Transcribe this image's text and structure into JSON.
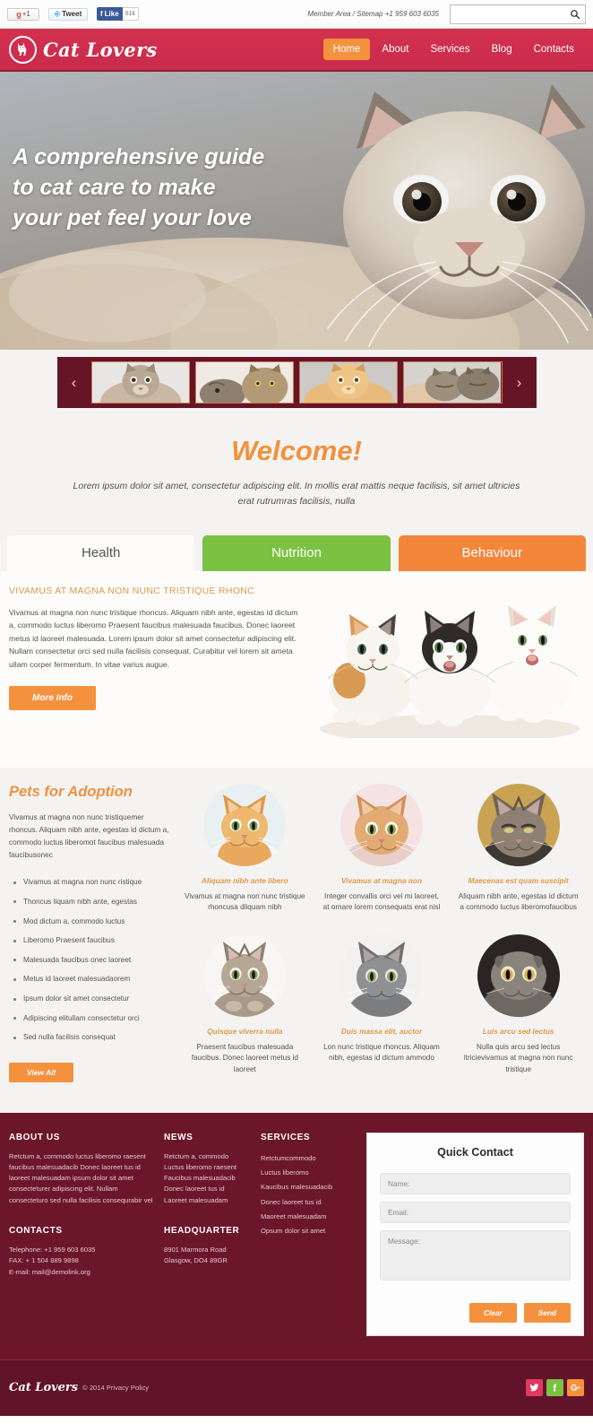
{
  "topbar": {
    "gplus_label": "+1",
    "gplus_icon": "google-plus-icon",
    "tweet_label": "Tweet",
    "tweet_icon": "twitter-bird-icon",
    "fb_like_label": "Like",
    "fb_count_label": "81k",
    "links_text": "Member Area / Sitemap +1 959 603 6035",
    "search_placeholder": "",
    "search_value": "",
    "search_icon": "search-icon"
  },
  "header": {
    "logo_text": "Cat Lovers",
    "logo_icon": "cat-silhouette-icon",
    "nav": [
      {
        "label": "Home",
        "active": true
      },
      {
        "label": "About",
        "active": false
      },
      {
        "label": "Services",
        "active": false
      },
      {
        "label": "Blog",
        "active": false
      },
      {
        "label": "Contacts",
        "active": false
      }
    ]
  },
  "hero": {
    "line1": "A comprehensive guide",
    "line2": "to cat care to make",
    "line3": "your pet feel your love",
    "image_alt": "close-up of a fluffy cream cat lying down"
  },
  "carousel": {
    "prev_icon": "chevron-left-icon",
    "next_icon": "chevron-right-icon",
    "thumbs": [
      {
        "alt": "grey tabby cat portrait"
      },
      {
        "alt": "two tabby cats nuzzling"
      },
      {
        "alt": "fluffy orange persian cat"
      },
      {
        "alt": "sleeping kittens in hand"
      }
    ]
  },
  "welcome": {
    "title": "Welcome!",
    "text": "Lorem ipsum dolor sit amet, consectetur adipiscing elit. In mollis erat mattis neque facilisis, sit amet ultricies erat rutrumras facilisis, nulla"
  },
  "tabs": {
    "items": [
      {
        "label": "Health",
        "state": "active"
      },
      {
        "label": "Nutrition",
        "state": "green"
      },
      {
        "label": "Behaviour",
        "state": "orange"
      }
    ],
    "panel": {
      "heading": "VIVAMUS AT MAGNA NON NUNC TRISTIQUE RHONC",
      "body": "Vivamus at magna non nunc tristique rhoncus. Aliquam nibh ante, egestas id dictum a, commodo luctus liberomo Praesent faucibus malesuada faucibus. Donec laoreet metus id laoreet malesuada. Lorem ipsum dolor sit amet consectetur adipiscing elit. Nullam consectetur orci sed nulla facilisis consequat. Curabitur vel lorem sit ameta ullam corper fermentum. In vitae varius augue.",
      "button_label": "More Info",
      "image_alt": "three kittens sitting together"
    }
  },
  "adoption": {
    "title": "Pets for Adoption",
    "intro": "Vivamus at magna non nunc tristiquemer rhoncus. Aliquam nibh ante, egestas id dictum a, commodo luctus liberomot faucibus malesuada faucibusonec",
    "list": [
      "Vivamus at magna non nunc ristique",
      "Thoncus liquam nibh ante, egestas",
      "Mod dictum a, commodo luctus",
      "Liberomo Praesent faucibus",
      "Malesuada faucibus onec laoreet",
      "Metus id laoreet malesuadaorem",
      "Ipsum dolor sit amet consectetur",
      "Adipiscing elitullam consectetur orci",
      "Sed nulla facilisis consequat"
    ],
    "view_all_label": "View All",
    "cards": [
      {
        "title": "Aliquam nibh ante libero",
        "desc": "Vivamus at magna non nunc tristique rhoncusa dliquam nibh",
        "image_alt": "orange kitten"
      },
      {
        "title": "Vivamus at magna non",
        "desc": "Integer convallis orci vel mi laoreet, at ornare lorem consequats erat nisl",
        "image_alt": "ginger cat close-up"
      },
      {
        "title": "Maecenas est quam suscipit",
        "desc": "Aliquam nibh ante, egestas id dictum a commodo luctus liberomofaucibus",
        "image_alt": "tabby cat squinting"
      },
      {
        "title": "Quisque viverra nulla",
        "desc": "Praesent faucibus malesuada faucibus. Donec laoreet metus id laoreet",
        "image_alt": "tabby kitten standing"
      },
      {
        "title": "Duis massa elit, auctor",
        "desc": "Lon nunc tristique rhoncus. Aliquam nibh, egestas id dictum ammodo",
        "image_alt": "grey british shorthair cat"
      },
      {
        "title": "Luis arcu sed lectus",
        "desc": "Nulla quis arcu sed lectus ltricievivamus at magna non nunc tristique",
        "image_alt": "grey scottish fold cat"
      }
    ]
  },
  "footer": {
    "about_heading": "ABOUT US",
    "about_text": "Retctum a, commodo luctus liberomo raesent faucibus malesuadacib Donec laoreet tus id laoreet malesuadam ipsum dolor sit amet consecteturer adipiscing elit. Nullam consecteturo sed nulla facilisis consequrabir vel",
    "contacts_heading": "CONTACTS",
    "contacts": [
      "Telephone: +1 959 603 6035",
      "FAX: + 1 504 889 9898",
      "E-mail: mail@demolink.org"
    ],
    "news_heading": "NEWS",
    "news": [
      "Retctum a, commodo",
      "Luctus liberomo raesent",
      "Faucibus malesuadacib",
      "Donec laoreet tus id",
      "Laoreet malesuadam"
    ],
    "hq_heading": "HEADQUARTER",
    "hq": [
      "8901 Marmora Road",
      "Glasgow, DO4 89GR"
    ],
    "services_heading": "SERVICES",
    "services": [
      "Retctumcommodo",
      "Luctus liberomo",
      "Kaucibus malesuadacib",
      "Donec laoreet tus id",
      "Maoreet malesuadam",
      "Opsum dolor sit amet"
    ],
    "quick_contact": {
      "title": "Quick Contact",
      "name_placeholder": "Name:",
      "email_placeholder": "Email:",
      "message_placeholder": "Message:",
      "name_value": "",
      "email_value": "",
      "message_value": "",
      "clear_label": "Clear",
      "send_label": "Send"
    }
  },
  "copyright": {
    "logo_text": "Cat Lovers",
    "text": "© 2014 Privacy Policy",
    "social": [
      {
        "name": "twitter-icon",
        "glyph": "t"
      },
      {
        "name": "facebook-icon",
        "glyph": "f"
      },
      {
        "name": "google-plus-icon",
        "glyph": "g"
      }
    ]
  },
  "colors": {
    "brand_red": "#cf3050",
    "dark_maroon": "#6b1629",
    "accent_orange": "#f4913f",
    "accent_green": "#7cc242",
    "body_bg": "#f4f3f1"
  }
}
